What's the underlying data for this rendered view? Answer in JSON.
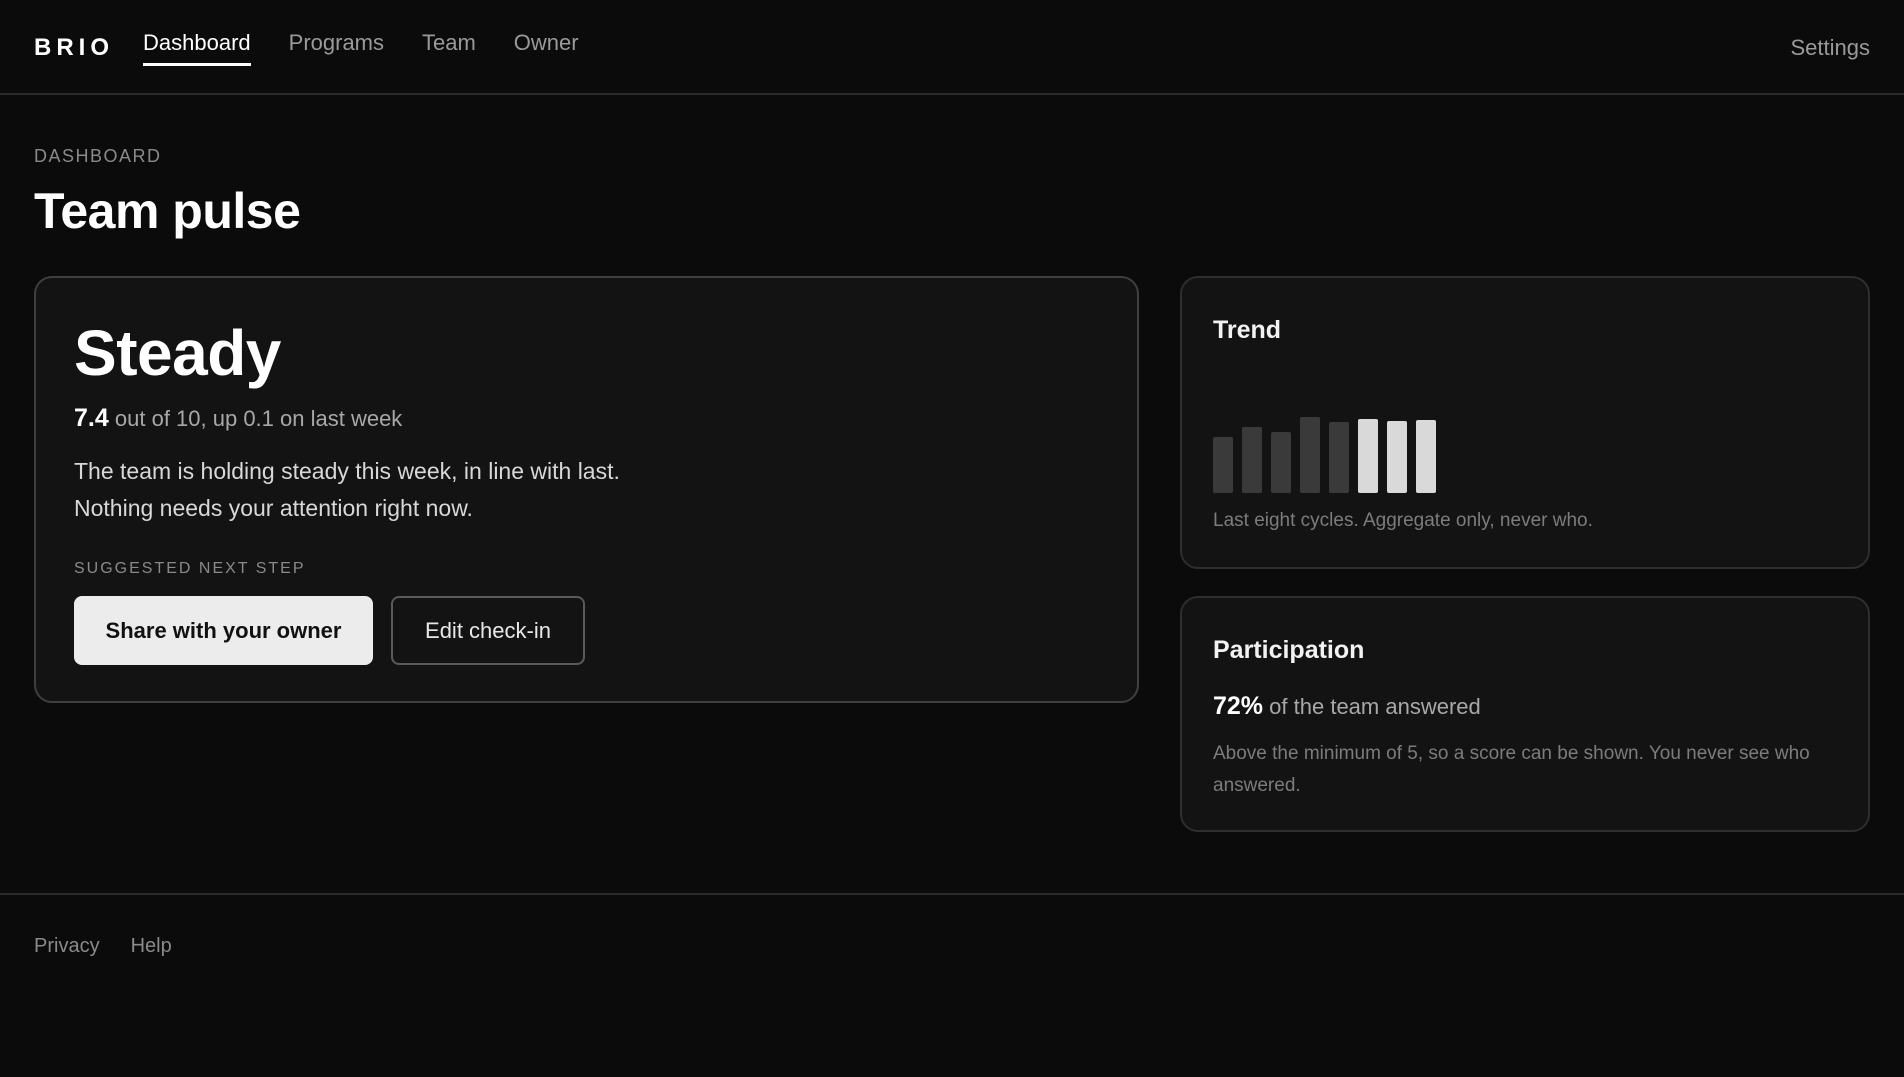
{
  "header": {
    "logo": "BRIO",
    "nav": [
      {
        "label": "Dashboard",
        "active": true
      },
      {
        "label": "Programs",
        "active": false
      },
      {
        "label": "Team",
        "active": false
      },
      {
        "label": "Owner",
        "active": false
      }
    ],
    "settings_label": "Settings"
  },
  "page": {
    "eyebrow": "DASHBOARD",
    "title": "Team pulse"
  },
  "pulse": {
    "status": "Steady",
    "score": "7.4",
    "score_suffix": "out of 10, up 0.1 on last week",
    "summary_line1": "The team is holding steady this week, in line with last.",
    "summary_line2": "Nothing needs your attention right now.",
    "next_step_label": "SUGGESTED NEXT STEP",
    "primary_button": "Share with your owner",
    "secondary_button": "Edit check-in"
  },
  "trend": {
    "title": "Trend",
    "caption": "Last eight cycles. Aggregate only, never who.",
    "cycles": [
      5.5,
      6.5,
      6.0,
      7.5,
      7.0,
      7.3,
      7.1,
      7.2
    ],
    "highlight_from": 5,
    "colors": {
      "past": "#3a3a3a",
      "recent": "#d9d9d9"
    }
  },
  "participation": {
    "title": "Participation",
    "percent": "72%",
    "suffix": "of the team answered",
    "note": "Above the minimum of 5, so a score can be shown. You never see who answered."
  },
  "footer": {
    "links": [
      "Privacy",
      "Help"
    ]
  }
}
